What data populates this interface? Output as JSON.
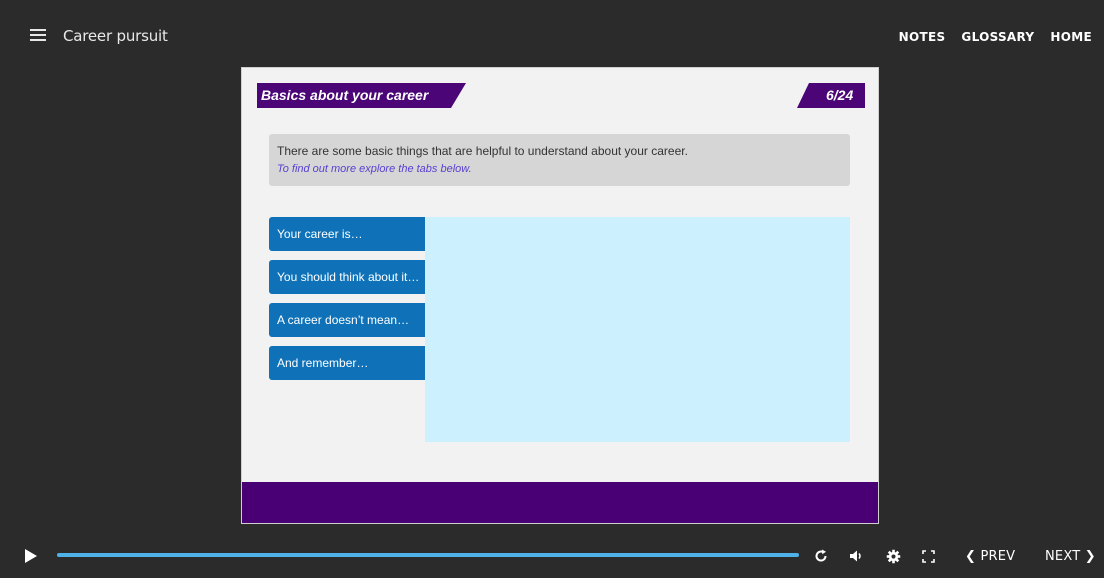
{
  "header": {
    "course_title": "Career pursuit",
    "nav": {
      "notes": "NOTES",
      "glossary": "GLOSSARY",
      "home": "HOME"
    }
  },
  "slide": {
    "title": "Basics about your career",
    "counter": "6/24",
    "intro_text": "There are some basic things that are helpful to understand about your career.",
    "intro_hint": "To find out more explore the tabs below.",
    "tabs": [
      {
        "label": "Your career is…"
      },
      {
        "label": "You should think about it…"
      },
      {
        "label": "A career doesn’t mean…"
      },
      {
        "label": "And remember…"
      }
    ]
  },
  "player": {
    "progress": 1.0,
    "prev_label": "PREV",
    "next_label": "NEXT",
    "icons": [
      "play-icon",
      "replay-icon",
      "volume-icon",
      "settings-icon",
      "fullscreen-icon",
      "chevron-left-icon",
      "chevron-right-icon"
    ]
  },
  "colors": {
    "accent_purple": "#4b0577",
    "tab_blue": "#0f72b8",
    "panel_blue": "#cdf0fe",
    "progress_blue": "#4eb2e8",
    "background": "#2b2b2b"
  }
}
